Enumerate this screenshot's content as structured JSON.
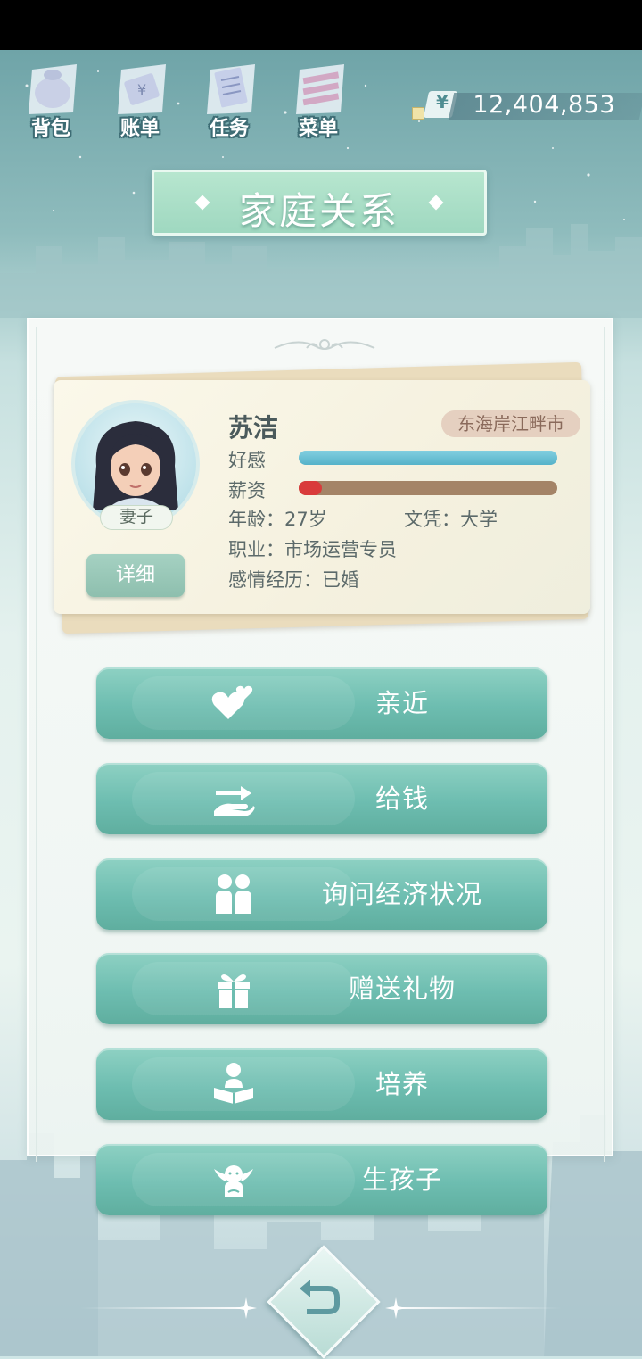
{
  "nav": {
    "items": [
      {
        "label": "背包",
        "icon": "bag-icon"
      },
      {
        "label": "账单",
        "icon": "bill-icon"
      },
      {
        "label": "任务",
        "icon": "task-icon"
      },
      {
        "label": "菜单",
        "icon": "menu-icon"
      }
    ]
  },
  "money": {
    "symbol": "¥",
    "value": "12,404,853"
  },
  "title": "家庭关系",
  "profile": {
    "name": "苏洁",
    "location": "东海岸江畔市",
    "role": "妻子",
    "detail_label": "详细",
    "favor_label": "好感",
    "favor_level": 1.0,
    "salary_label": "薪资",
    "salary_level": 0.09,
    "age": "年龄：27岁",
    "education": "文凭：大学",
    "occupation": "职业：市场运营专员",
    "relationship": "感情经历：已婚"
  },
  "actions": [
    {
      "label": "亲近",
      "icon": "hearts-icon"
    },
    {
      "label": "给钱",
      "icon": "give-money-icon"
    },
    {
      "label": "询问经济状况",
      "icon": "two-people-icon"
    },
    {
      "label": "赠送礼物",
      "icon": "gift-icon"
    },
    {
      "label": "培养",
      "icon": "reading-child-icon"
    },
    {
      "label": "生孩子",
      "icon": "angel-baby-icon"
    }
  ],
  "colors": {
    "accent": "#6dbdb0",
    "title_banner": "#a8dcc5",
    "favor_fill": "#55b2c9",
    "salary_fill": "#d93b3b"
  }
}
